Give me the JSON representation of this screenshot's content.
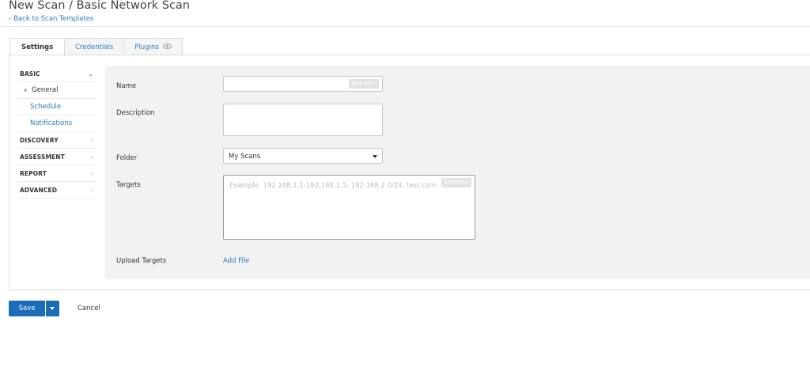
{
  "header": {
    "title": "New Scan / Basic Network Scan",
    "back_label": "Back to Scan Templates"
  },
  "tabs": [
    {
      "label": "Settings",
      "active": true
    },
    {
      "label": "Credentials",
      "active": false
    },
    {
      "label": "Plugins",
      "active": false,
      "icon": "eye-icon"
    }
  ],
  "sidebar": {
    "sections": [
      {
        "label": "BASIC",
        "open": true
      },
      {
        "label": "DISCOVERY",
        "open": false
      },
      {
        "label": "ASSESSMENT",
        "open": false
      },
      {
        "label": "REPORT",
        "open": false
      },
      {
        "label": "ADVANCED",
        "open": false
      }
    ],
    "basic_items": [
      {
        "label": "General",
        "current": true
      },
      {
        "label": "Schedule",
        "current": false
      },
      {
        "label": "Notifications",
        "current": false
      }
    ]
  },
  "form": {
    "name": {
      "label": "Name",
      "value": "",
      "badge": "REQUIRED"
    },
    "description": {
      "label": "Description",
      "value": ""
    },
    "folder": {
      "label": "Folder",
      "value": "My Scans"
    },
    "targets": {
      "label": "Targets",
      "placeholder": "Example: 192.168.1.1-192.168.1.5, 192.168.2.0/24, test.com",
      "badge": "REQUIRED"
    },
    "upload_targets": {
      "label": "Upload Targets",
      "action": "Add File"
    }
  },
  "footer": {
    "save_label": "Save",
    "cancel_label": "Cancel"
  },
  "colors": {
    "accent": "#1b6db8",
    "link": "#2a7bbf",
    "form_bg": "#f2f2f2"
  }
}
